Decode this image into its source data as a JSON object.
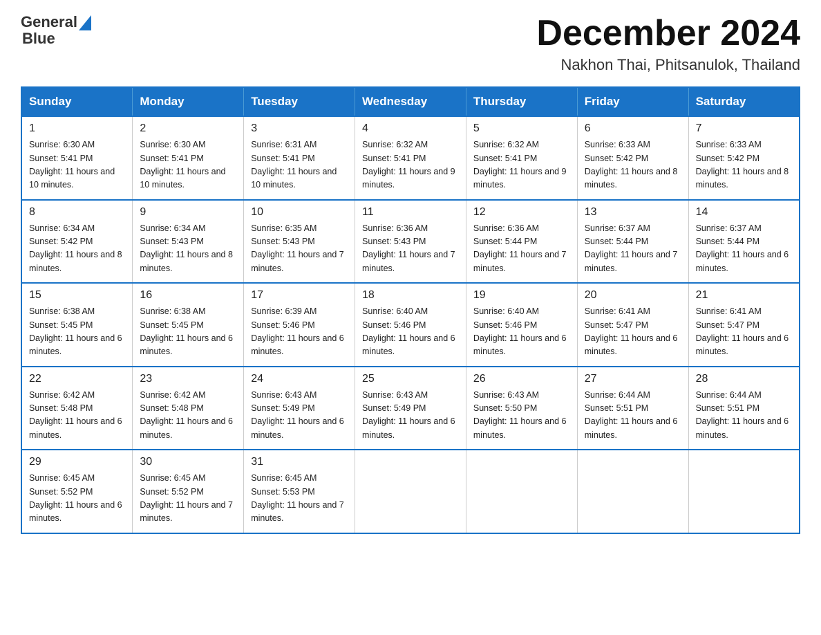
{
  "header": {
    "logo_text_general": "General",
    "logo_text_blue": "Blue",
    "month_title": "December 2024",
    "location": "Nakhon Thai, Phitsanulok, Thailand"
  },
  "weekdays": [
    "Sunday",
    "Monday",
    "Tuesday",
    "Wednesday",
    "Thursday",
    "Friday",
    "Saturday"
  ],
  "weeks": [
    [
      {
        "day": "1",
        "sunrise": "6:30 AM",
        "sunset": "5:41 PM",
        "daylight": "11 hours and 10 minutes."
      },
      {
        "day": "2",
        "sunrise": "6:30 AM",
        "sunset": "5:41 PM",
        "daylight": "11 hours and 10 minutes."
      },
      {
        "day": "3",
        "sunrise": "6:31 AM",
        "sunset": "5:41 PM",
        "daylight": "11 hours and 10 minutes."
      },
      {
        "day": "4",
        "sunrise": "6:32 AM",
        "sunset": "5:41 PM",
        "daylight": "11 hours and 9 minutes."
      },
      {
        "day": "5",
        "sunrise": "6:32 AM",
        "sunset": "5:41 PM",
        "daylight": "11 hours and 9 minutes."
      },
      {
        "day": "6",
        "sunrise": "6:33 AM",
        "sunset": "5:42 PM",
        "daylight": "11 hours and 8 minutes."
      },
      {
        "day": "7",
        "sunrise": "6:33 AM",
        "sunset": "5:42 PM",
        "daylight": "11 hours and 8 minutes."
      }
    ],
    [
      {
        "day": "8",
        "sunrise": "6:34 AM",
        "sunset": "5:42 PM",
        "daylight": "11 hours and 8 minutes."
      },
      {
        "day": "9",
        "sunrise": "6:34 AM",
        "sunset": "5:43 PM",
        "daylight": "11 hours and 8 minutes."
      },
      {
        "day": "10",
        "sunrise": "6:35 AM",
        "sunset": "5:43 PM",
        "daylight": "11 hours and 7 minutes."
      },
      {
        "day": "11",
        "sunrise": "6:36 AM",
        "sunset": "5:43 PM",
        "daylight": "11 hours and 7 minutes."
      },
      {
        "day": "12",
        "sunrise": "6:36 AM",
        "sunset": "5:44 PM",
        "daylight": "11 hours and 7 minutes."
      },
      {
        "day": "13",
        "sunrise": "6:37 AM",
        "sunset": "5:44 PM",
        "daylight": "11 hours and 7 minutes."
      },
      {
        "day": "14",
        "sunrise": "6:37 AM",
        "sunset": "5:44 PM",
        "daylight": "11 hours and 6 minutes."
      }
    ],
    [
      {
        "day": "15",
        "sunrise": "6:38 AM",
        "sunset": "5:45 PM",
        "daylight": "11 hours and 6 minutes."
      },
      {
        "day": "16",
        "sunrise": "6:38 AM",
        "sunset": "5:45 PM",
        "daylight": "11 hours and 6 minutes."
      },
      {
        "day": "17",
        "sunrise": "6:39 AM",
        "sunset": "5:46 PM",
        "daylight": "11 hours and 6 minutes."
      },
      {
        "day": "18",
        "sunrise": "6:40 AM",
        "sunset": "5:46 PM",
        "daylight": "11 hours and 6 minutes."
      },
      {
        "day": "19",
        "sunrise": "6:40 AM",
        "sunset": "5:46 PM",
        "daylight": "11 hours and 6 minutes."
      },
      {
        "day": "20",
        "sunrise": "6:41 AM",
        "sunset": "5:47 PM",
        "daylight": "11 hours and 6 minutes."
      },
      {
        "day": "21",
        "sunrise": "6:41 AM",
        "sunset": "5:47 PM",
        "daylight": "11 hours and 6 minutes."
      }
    ],
    [
      {
        "day": "22",
        "sunrise": "6:42 AM",
        "sunset": "5:48 PM",
        "daylight": "11 hours and 6 minutes."
      },
      {
        "day": "23",
        "sunrise": "6:42 AM",
        "sunset": "5:48 PM",
        "daylight": "11 hours and 6 minutes."
      },
      {
        "day": "24",
        "sunrise": "6:43 AM",
        "sunset": "5:49 PM",
        "daylight": "11 hours and 6 minutes."
      },
      {
        "day": "25",
        "sunrise": "6:43 AM",
        "sunset": "5:49 PM",
        "daylight": "11 hours and 6 minutes."
      },
      {
        "day": "26",
        "sunrise": "6:43 AM",
        "sunset": "5:50 PM",
        "daylight": "11 hours and 6 minutes."
      },
      {
        "day": "27",
        "sunrise": "6:44 AM",
        "sunset": "5:51 PM",
        "daylight": "11 hours and 6 minutes."
      },
      {
        "day": "28",
        "sunrise": "6:44 AM",
        "sunset": "5:51 PM",
        "daylight": "11 hours and 6 minutes."
      }
    ],
    [
      {
        "day": "29",
        "sunrise": "6:45 AM",
        "sunset": "5:52 PM",
        "daylight": "11 hours and 6 minutes."
      },
      {
        "day": "30",
        "sunrise": "6:45 AM",
        "sunset": "5:52 PM",
        "daylight": "11 hours and 7 minutes."
      },
      {
        "day": "31",
        "sunrise": "6:45 AM",
        "sunset": "5:53 PM",
        "daylight": "11 hours and 7 minutes."
      },
      null,
      null,
      null,
      null
    ]
  ]
}
